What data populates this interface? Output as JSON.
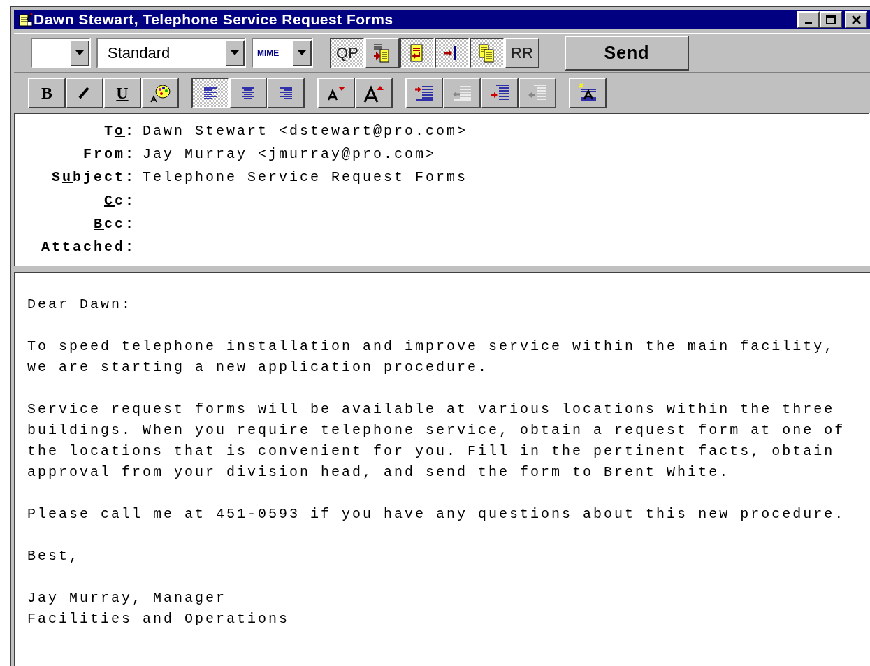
{
  "window": {
    "title": "Dawn Stewart, Telephone Service Request Forms"
  },
  "toolbar": {
    "dropdowns": [
      {
        "kind": "blank"
      },
      {
        "kind": "plain",
        "value": "Standard"
      },
      {
        "kind": "small",
        "value": "MIME"
      }
    ],
    "buttons": [
      {
        "kind": "text",
        "label": "QP",
        "pressed": true
      },
      {
        "kind": "insert-file",
        "pressed": false
      },
      {
        "kind": "wrap",
        "pressed": true
      },
      {
        "kind": "tab",
        "pressed": true
      },
      {
        "kind": "copy",
        "pressed": true
      },
      {
        "kind": "text",
        "label": "RR",
        "pressed": false
      }
    ],
    "send": "Send"
  },
  "format_bar": {
    "groups": [
      [
        {
          "kind": "text",
          "label": "B"
        },
        {
          "kind": "italic"
        },
        {
          "kind": "underline",
          "label": "U"
        },
        {
          "kind": "palette"
        }
      ],
      [
        {
          "kind": "align-left",
          "pressed": true
        },
        {
          "kind": "align-center",
          "pressed": false
        },
        {
          "kind": "align-right",
          "pressed": false
        }
      ],
      [
        {
          "kind": "smaller"
        },
        {
          "kind": "larger"
        }
      ],
      [
        {
          "kind": "indent",
          "disabled": false
        },
        {
          "kind": "outdent",
          "disabled": true
        },
        {
          "kind": "indent-block",
          "disabled": false
        },
        {
          "kind": "outdent-block",
          "disabled": true
        }
      ],
      [
        {
          "kind": "highlight"
        }
      ]
    ]
  },
  "header": [
    {
      "label": [
        {
          "text": "T",
          "underlined": false
        },
        {
          "text": "o",
          "underlined": true
        },
        {
          "text": ":",
          "underlined": false
        }
      ],
      "value": "Dawn Stewart <dstewart@pro.com>"
    },
    {
      "label": [
        {
          "text": "From:",
          "underlined": false
        }
      ],
      "value": "Jay Murray <jmurray@pro.com>"
    },
    {
      "label": [
        {
          "text": "S",
          "underlined": false
        },
        {
          "text": "u",
          "underlined": true
        },
        {
          "text": "bject:",
          "underlined": false
        }
      ],
      "value": "Telephone Service Request Forms"
    },
    {
      "label": [
        {
          "text": "C",
          "underlined": true
        },
        {
          "text": "c:",
          "underlined": false
        }
      ]
    },
    {
      "label": [
        {
          "text": "B",
          "underlined": true
        },
        {
          "text": "cc:",
          "underlined": false
        }
      ]
    },
    {
      "label": [
        {
          "text": "Attached:",
          "underlined": false
        }
      ]
    }
  ],
  "body": [
    "Dear Dawn:",
    "To speed telephone installation and improve service within the main facility, we are starting a new application procedure.",
    "Service request forms will be available at various locations within the three buildings. When you require telephone service, obtain a request form at one of the locations that is convenient for you. Fill in the pertinent facts, obtain approval from your division head, and send the form to Brent White.",
    "Please call me at 451-0593 if you have any questions about this new procedure.",
    "Best,",
    "Jay Murray, Manager\nFacilities and Operations"
  ]
}
